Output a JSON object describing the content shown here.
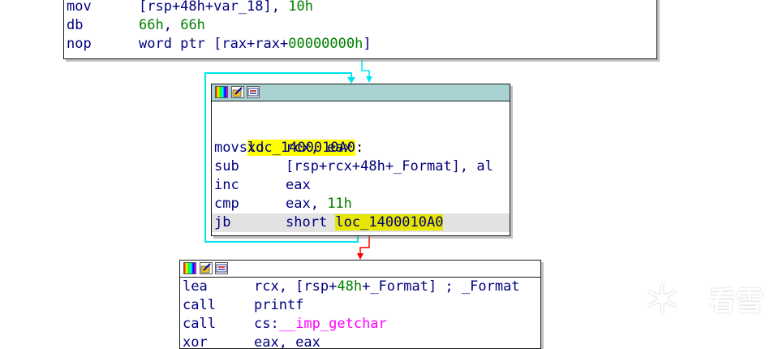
{
  "colors": {
    "edge_loop": "#00e5ee",
    "edge_false": "#ff0000",
    "title_bar": "#a9d3d2",
    "label_highlight": "#ffff00",
    "mnemonic": "#000080",
    "number": "#008000",
    "import": "#ff00ff"
  },
  "top_block": {
    "lines": [
      {
        "mnemonic": "mov",
        "operand_pre": "[rsp+48h+var_18], ",
        "operand_num": "10h",
        "operand_post": ""
      },
      {
        "mnemonic": "db",
        "operand_pre": "",
        "operand_num": "66h",
        "operand_post": ", ",
        "operand_num2": "66h"
      },
      {
        "mnemonic": "nop",
        "operand_pre": "word ptr [rax+rax+",
        "operand_num": "00000000h",
        "operand_post": "]"
      }
    ]
  },
  "loop_block": {
    "label": "loc_1400010A0",
    "label_suffix": ":",
    "lines": [
      {
        "mnemonic": "movsxd",
        "operands": "rcx, eax"
      },
      {
        "mnemonic": "sub",
        "operands": "[rsp+rcx+48h+_Format], al"
      },
      {
        "mnemonic": "inc",
        "operands": "eax"
      },
      {
        "mnemonic": "cmp",
        "operand_pre": "eax, ",
        "operand_num": "11h"
      },
      {
        "mnemonic": "jb",
        "operand_pre": "short ",
        "target": "loc_1400010A0"
      }
    ]
  },
  "bottom_block": {
    "lines": [
      {
        "mnemonic": "lea",
        "operand_pre": "rcx, [rsp+",
        "operand_num": "48h",
        "operand_post": "+_Format] ; _Format"
      },
      {
        "mnemonic": "call",
        "operand": "printf"
      },
      {
        "mnemonic": "call",
        "operand_pre": "cs:",
        "import": "__imp_getchar"
      },
      {
        "mnemonic": "xor",
        "operands": "eax, eax"
      }
    ]
  },
  "watermark": {
    "text": "看雪"
  }
}
